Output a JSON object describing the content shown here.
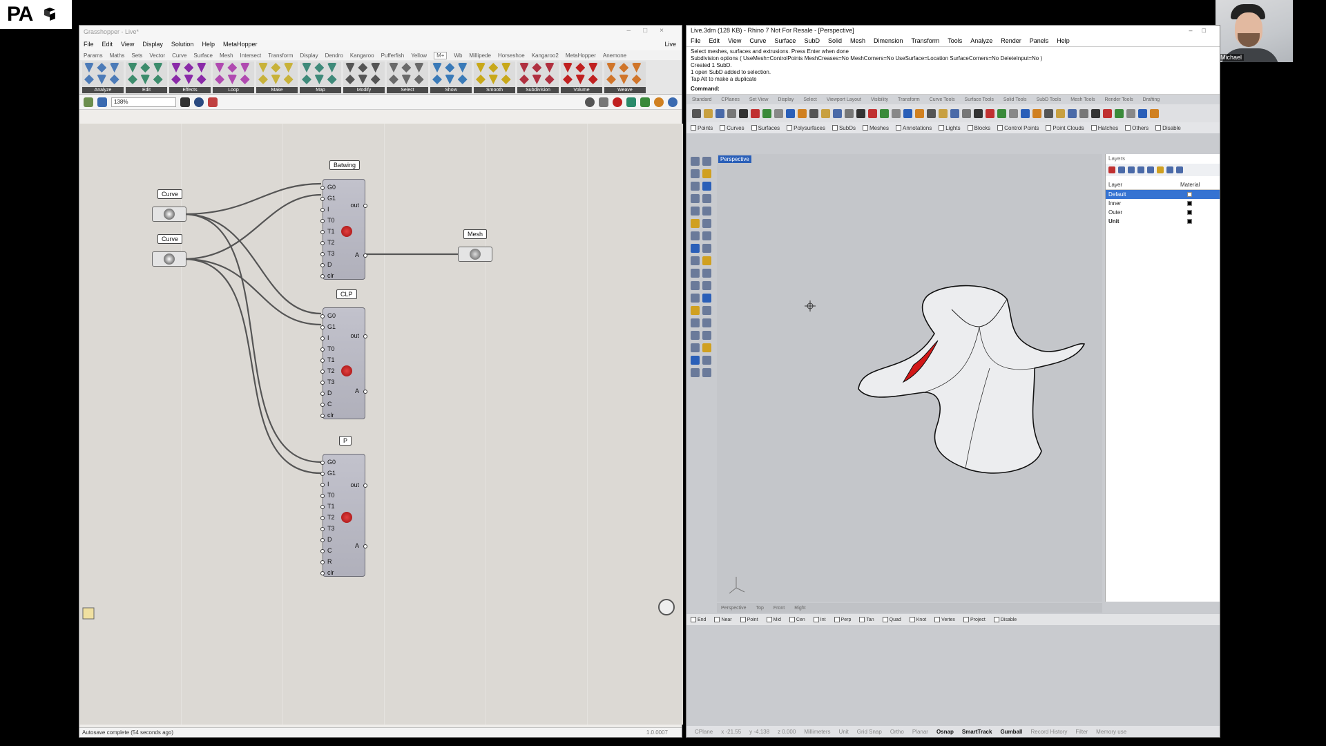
{
  "logo": {
    "text": "PA"
  },
  "webcam": {
    "name": "Michael"
  },
  "grasshopper": {
    "title": "Grasshopper - Live*",
    "menu": [
      "File",
      "Edit",
      "View",
      "Display",
      "Solution",
      "Help",
      "MetaHopper"
    ],
    "live_label": "Live",
    "tabs": [
      "Params",
      "Maths",
      "Sets",
      "Vector",
      "Curve",
      "Surface",
      "Mesh",
      "Intersect",
      "Transform",
      "Display",
      "Dendro",
      "Kangaroo",
      "Pufferfish",
      "Yellow",
      "M+",
      "Wb",
      "Millipede",
      "Horseshoe",
      "Kangaroo2",
      "MetaHopper",
      "Anemone"
    ],
    "active_tab": "M+",
    "ribbon_groups": [
      {
        "label": "Analyze",
        "color": "#4c7bb8"
      },
      {
        "label": "Edit",
        "color": "#3c8c6c"
      },
      {
        "label": "Effects",
        "color": "#8a2aa8"
      },
      {
        "label": "Loop",
        "color": "#b04ab0"
      },
      {
        "label": "Make",
        "color": "#c8b23a"
      },
      {
        "label": "Map",
        "color": "#3f8a7a"
      },
      {
        "label": "Modify",
        "color": "#555555"
      },
      {
        "label": "Select",
        "color": "#6a6a6a"
      },
      {
        "label": "Show",
        "color": "#3a7ab8"
      },
      {
        "label": "Smooth",
        "color": "#c8a81a"
      },
      {
        "label": "Subdivision",
        "color": "#b03040"
      },
      {
        "label": "Volume",
        "color": "#c02020"
      },
      {
        "label": "Weave",
        "color": "#d0752a"
      }
    ],
    "zoom": "138%",
    "status": "Autosave complete (54 seconds ago)",
    "version": "1.0.0007",
    "components": {
      "curve_label": "Curve",
      "mesh_label": "Mesh",
      "batwing": {
        "label": "Batwing",
        "inputs": [
          "G0",
          "G1",
          "I",
          "T0",
          "T1",
          "T2",
          "T3",
          "D",
          "clr"
        ],
        "outputs": [
          "out",
          "A"
        ]
      },
      "clp": {
        "label": "CLP",
        "inputs": [
          "G0",
          "G1",
          "I",
          "T0",
          "T1",
          "T2",
          "T3",
          "D",
          "C",
          "clr"
        ],
        "outputs": [
          "out",
          "A"
        ]
      },
      "p": {
        "label": "P",
        "inputs": [
          "G0",
          "G1",
          "I",
          "T0",
          "T1",
          "T2",
          "T3",
          "D",
          "C",
          "R",
          "clr"
        ],
        "outputs": [
          "out",
          "A"
        ]
      }
    }
  },
  "rhino": {
    "title": "Live.3dm (128 KB) - Rhino 7 Not For Resale - [Perspective]",
    "menu": [
      "File",
      "Edit",
      "View",
      "Curve",
      "Surface",
      "SubD",
      "Solid",
      "Mesh",
      "Dimension",
      "Transform",
      "Tools",
      "Analyze",
      "Render",
      "Panels",
      "Help"
    ],
    "command_history": [
      "Select meshes, surfaces and extrusions. Press Enter when done",
      "Subdivision options ( UseMesh=ControlPoints  MeshCreases=No  MeshCorners=No  UseSurface=Location  SurfaceCorners=No  DeleteInput=No )",
      "Created 1 SubD.",
      "1 open SubD added to selection.",
      "Tap Alt to make a duplicate"
    ],
    "command_prompt": "Command:",
    "toolbar_tabs": [
      "Standard",
      "CPlanes",
      "Set View",
      "Display",
      "Select",
      "Viewport Layout",
      "Visibility",
      "Transform",
      "Curve Tools",
      "Surface Tools",
      "Solid Tools",
      "SubD Tools",
      "Mesh Tools",
      "Render Tools",
      "Drafting"
    ],
    "filters": [
      "Points",
      "Curves",
      "Surfaces",
      "Polysurfaces",
      "SubDs",
      "Meshes",
      "Annotations",
      "Lights",
      "Blocks",
      "Control Points",
      "Point Clouds",
      "Hatches",
      "Others",
      "Disable"
    ],
    "viewport_label": "Perspective",
    "viewport_tabs": [
      "Perspective",
      "Top",
      "Front",
      "Right"
    ],
    "osnaps": [
      "End",
      "Near",
      "Point",
      "Mid",
      "Cen",
      "Int",
      "Perp",
      "Tan",
      "Quad",
      "Knot",
      "Vertex",
      "Project",
      "Disable"
    ],
    "status_items": [
      "CPlane",
      "x -21.55",
      "y -4.138",
      "z 0.000",
      "Millimeters",
      "Unit",
      "Grid Snap",
      "Ortho",
      "Planar",
      "Osnap",
      "SmartTrack",
      "Gumball",
      "Record History",
      "Filter",
      "Memory use"
    ],
    "status_on": [
      "Osnap",
      "SmartTrack",
      "Gumball"
    ],
    "layers": {
      "panel_title": "Layers",
      "col_layer": "Layer",
      "col_material": "Material",
      "rows": [
        {
          "name": "Default",
          "selected": true,
          "swatch": "white"
        },
        {
          "name": "Inner",
          "selected": false,
          "swatch": "black"
        },
        {
          "name": "Outer",
          "selected": false,
          "swatch": "black"
        },
        {
          "name": "Unit",
          "selected": false,
          "swatch": "black",
          "current": true
        }
      ]
    }
  }
}
